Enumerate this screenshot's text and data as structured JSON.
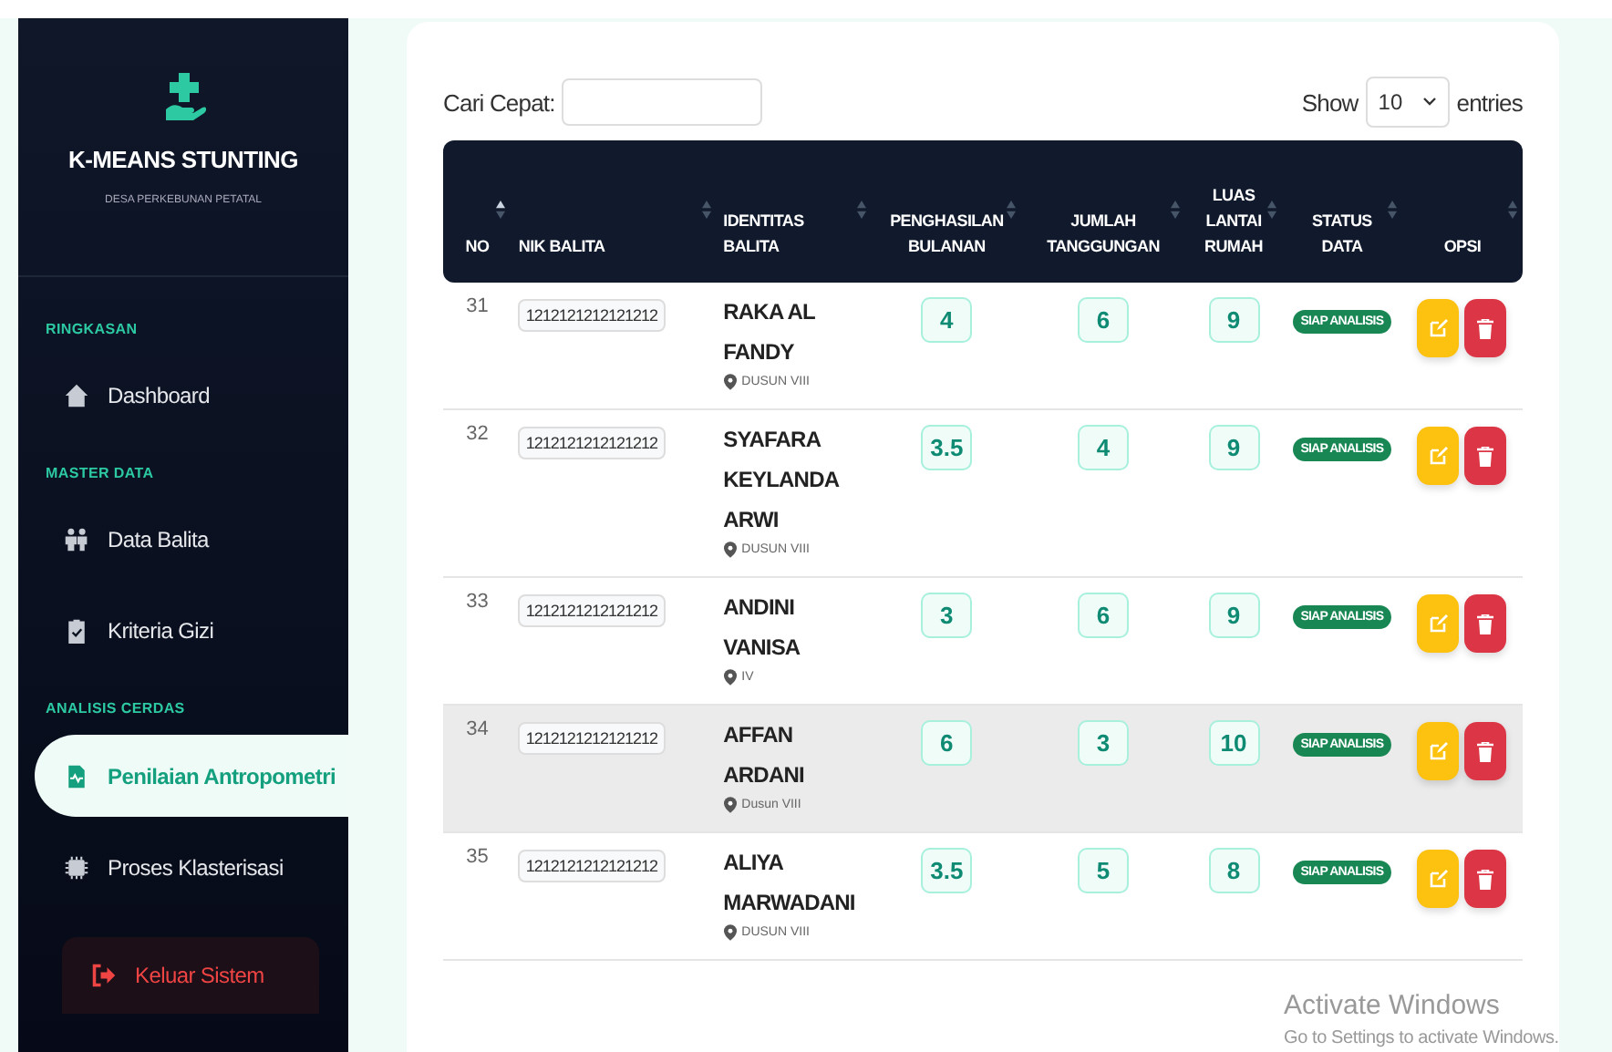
{
  "sidebar": {
    "brand": "K-MEANS STUNTING",
    "subtitle": "DESA PERKEBUNAN PETATAL",
    "sections": [
      {
        "title": "RINGKASAN",
        "items": [
          {
            "label": "Dashboard",
            "kind": "home",
            "selected": false
          }
        ]
      },
      {
        "title": "MASTER DATA",
        "items": [
          {
            "label": "Data Balita",
            "kind": "people",
            "selected": false
          },
          {
            "label": "Kriteria Gizi",
            "kind": "clipboard",
            "selected": false
          }
        ]
      },
      {
        "title": "ANALISIS CERDAS",
        "items": [
          {
            "label": "Penilaian Antropometri",
            "kind": "file",
            "selected": true
          },
          {
            "label": "Proses Klasterisasi",
            "kind": "chip",
            "selected": false
          }
        ]
      }
    ],
    "logout": "Keluar Sistem"
  },
  "search": {
    "label": "Cari Cepat:"
  },
  "length": {
    "before": "Show",
    "value": "10",
    "after": "entries"
  },
  "table": {
    "columns": [
      "NO",
      "NIK BALITA",
      "IDENTITAS BALITA",
      "PENGHASILAN BULANAN",
      "JUMLAH TANGGUNGAN",
      "LUAS LANTAI RUMAH",
      "STATUS DATA",
      "OPSI"
    ],
    "rows": [
      {
        "no": "31",
        "nik": "1212121212121212",
        "name": "RAKA AL FANDY",
        "place": "DUSUN VIII",
        "income": "4",
        "dependents": "6",
        "floor": "9",
        "status": "SIAP ANALISIS",
        "highlighted": false
      },
      {
        "no": "32",
        "nik": "1212121212121212",
        "name": "SYAFARA KEYLANDA ARWI",
        "place": "DUSUN VIII",
        "income": "3.5",
        "dependents": "4",
        "floor": "9",
        "status": "SIAP ANALISIS",
        "highlighted": false
      },
      {
        "no": "33",
        "nik": "1212121212121212",
        "name": "ANDINI VANISA",
        "place": "IV",
        "income": "3",
        "dependents": "6",
        "floor": "9",
        "status": "SIAP ANALISIS",
        "highlighted": false
      },
      {
        "no": "34",
        "nik": "1212121212121212",
        "name": "AFFAN ARDANI",
        "place": "Dusun VIII",
        "income": "6",
        "dependents": "3",
        "floor": "10",
        "status": "SIAP ANALISIS",
        "highlighted": true
      },
      {
        "no": "35",
        "nik": "1212121212121212",
        "name": "ALIYA MARWADANI",
        "place": "DUSUN VIII",
        "income": "3.5",
        "dependents": "5",
        "floor": "8",
        "status": "SIAP ANALISIS",
        "highlighted": false
      }
    ]
  },
  "os_notice": {
    "title": "Activate Windows",
    "text": "Go to Settings to activate Windows."
  }
}
